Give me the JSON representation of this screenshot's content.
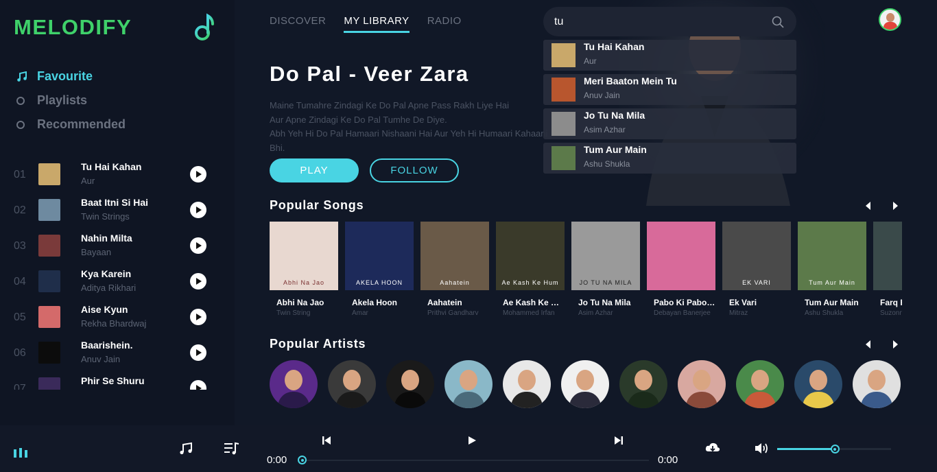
{
  "app": {
    "name": "MELODIFY"
  },
  "sidebar": {
    "nav": [
      {
        "label": "Favourite",
        "active": true
      },
      {
        "label": "Playlists",
        "active": false
      },
      {
        "label": "Recommended",
        "active": false
      }
    ],
    "songs": [
      {
        "num": "01",
        "title": "Tu Hai Kahan",
        "artist": "Aur",
        "color": "#c9a86a"
      },
      {
        "num": "02",
        "title": "Baat Itni Si Hai",
        "artist": "Twin Strings",
        "color": "#6e8aa0"
      },
      {
        "num": "03",
        "title": "Nahin Milta",
        "artist": "Bayaan",
        "color": "#7a3a3a"
      },
      {
        "num": "04",
        "title": "Kya Karein",
        "artist": "Aditya Rikhari",
        "color": "#1f2e4a"
      },
      {
        "num": "05",
        "title": "Aise Kyun",
        "artist": "Rekha Bhardwaj",
        "color": "#d46a6a"
      },
      {
        "num": "06",
        "title": "Baarishein.",
        "artist": "Anuv Jain",
        "color": "#0c0c0c"
      },
      {
        "num": "07",
        "title": "Phir Se Shuru",
        "artist": "",
        "color": "#3a2a5a"
      }
    ]
  },
  "tabs": [
    {
      "label": "DISCOVER",
      "active": false
    },
    {
      "label": "MY LIBRARY",
      "active": true
    },
    {
      "label": "RADIO",
      "active": false
    }
  ],
  "hero": {
    "title": "Do Pal - Veer Zara",
    "lines": [
      "Maine Tumahre Zindagi Ke Do Pal Apne Pass Rakh Liye Hai",
      "Aur Apne Zindagi Ke Do Pal Tumhe De Diye.",
      "Abh Yeh Hi Do Pal Hamaari Nishaani Hai Aur Yeh Hi Humaari Kahaani Bhi."
    ],
    "play_label": "PLAY",
    "follow_label": "FOLLOW"
  },
  "search": {
    "query": "tu",
    "results": [
      {
        "title": "Tu Hai Kahan",
        "artist": "Aur",
        "color": "#c9a86a"
      },
      {
        "title": "Meri Baaton Mein Tu",
        "artist": "Anuv Jain",
        "color": "#b8562e"
      },
      {
        "title": "Jo Tu Na Mila",
        "artist": "Asim Azhar",
        "color": "#8c8c8c"
      },
      {
        "title": "Tum Aur Main",
        "artist": "Ashu Shukla",
        "color": "#5c7a4a"
      }
    ]
  },
  "popular_songs": {
    "title": "Popular Songs",
    "items": [
      {
        "title": "Abhi Na Jao",
        "artist": "Twin String",
        "cap": "Abhi Na Jao",
        "bg": "#e8d8d0",
        "cap_color": "#7a3030"
      },
      {
        "title": "Akela Hoon",
        "artist": "Amar",
        "cap": "AKELA HOON",
        "bg": "#1d2a5a",
        "cap_color": "#ffffff"
      },
      {
        "title": "Aahatein",
        "artist": "Prithvi Gandharv",
        "cap": "Aahatein",
        "bg": "#6a5a48",
        "cap_color": "#ffffff"
      },
      {
        "title": "Ae Kash Ke Hum",
        "artist": "Mohammed Irfan",
        "cap": "Ae Kash Ke Hum",
        "bg": "#3a3a2a",
        "cap_color": "#ffffff"
      },
      {
        "title": "Jo Tu Na Mila",
        "artist": "Asim Azhar",
        "cap": "JO TU NA MILA",
        "bg": "#9a9a9a",
        "cap_color": "#222222"
      },
      {
        "title": "Pabo Ki Pabo Na",
        "artist": "Debayan Banerjee",
        "cap": "",
        "bg": "#d86a9a",
        "cap_color": "#ffffff"
      },
      {
        "title": "Ek Vari",
        "artist": "Mitraz",
        "cap": "EK VARI",
        "bg": "#4a4a4a",
        "cap_color": "#ffffff"
      },
      {
        "title": "Tum Aur Main",
        "artist": "Ashu Shukla",
        "cap": "Tum Aur Main",
        "bg": "#5c7a4a",
        "cap_color": "#ffffff"
      },
      {
        "title": "Farq Hai",
        "artist": "Suzonn",
        "cap": "",
        "bg": "#3a4a4a",
        "cap_color": "#ffffff"
      }
    ]
  },
  "popular_artists": {
    "title": "Popular Artists",
    "items": [
      {
        "bg": "#5a2a8a",
        "body": "#2a1a4a"
      },
      {
        "bg": "#3a3a3a",
        "body": "#1a1a1a"
      },
      {
        "bg": "#1a1a1a",
        "body": "#0a0a0a"
      },
      {
        "bg": "#8ab8c8",
        "body": "#4a6a7a"
      },
      {
        "bg": "#e8e8e8",
        "body": "#222222"
      },
      {
        "bg": "#f0f0f0",
        "body": "#2a2a3a"
      },
      {
        "bg": "#2a3a2a",
        "body": "#1a2a1a"
      },
      {
        "bg": "#d8a8a0",
        "body": "#8a4a3a"
      },
      {
        "bg": "#4a8a4a",
        "body": "#c85a3a"
      },
      {
        "bg": "#2a4a6a",
        "body": "#e8c84a"
      },
      {
        "bg": "#e0e0e0",
        "body": "#3a5a8a"
      }
    ]
  },
  "player": {
    "current_time": "0:00",
    "total_time": "0:00",
    "progress": 0,
    "volume": 0.51
  }
}
